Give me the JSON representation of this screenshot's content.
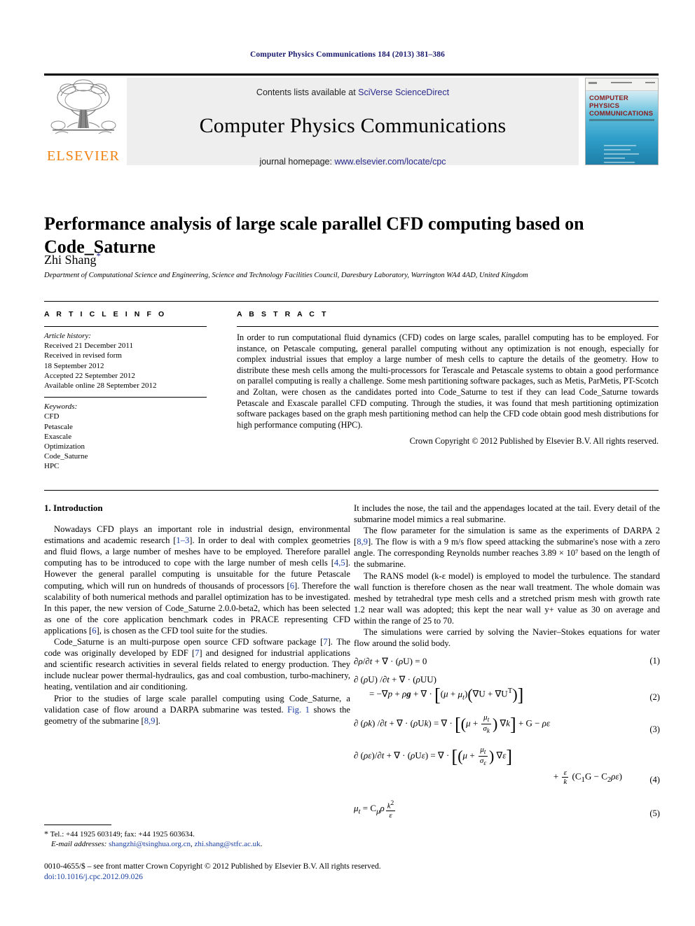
{
  "running_head": "Computer Physics Communications 184 (2013) 381–386",
  "masthead": {
    "contents_prefix": "Contents lists available at ",
    "contents_link": "SciVerse ScienceDirect",
    "journal_title": "Computer Physics Communications",
    "homepage_prefix": "journal homepage: ",
    "homepage_link": "www.elsevier.com/locate/cpc",
    "publisher_wordmark": "ELSEVIER",
    "cover_title_line1": "COMPUTER PHYSICS",
    "cover_title_line2": "COMMUNICATIONS"
  },
  "article": {
    "title": "Performance analysis of large scale parallel CFD computing based on Code_Saturne",
    "author": "Zhi Shang",
    "author_marker": "*",
    "affiliation": "Department of Computational Science and Engineering, Science and Technology Facilities Council, Daresbury Laboratory, Warrington WA4 4AD, United Kingdom"
  },
  "article_info": {
    "heading": "A R T I C L E   I N F O",
    "history_label": "Article history:",
    "history": [
      "Received 21 December 2011",
      "Received in revised form",
      "18 September 2012",
      "Accepted 22 September 2012",
      "Available online 28 September 2012"
    ],
    "keywords_label": "Keywords:",
    "keywords": [
      "CFD",
      "Petascale",
      "Exascale",
      "Optimization",
      "Code_Saturne",
      "HPC"
    ]
  },
  "abstract": {
    "heading": "A B S T R A C T",
    "text": "In order to run computational fluid dynamics (CFD) codes on large scales, parallel computing has to be employed. For instance, on Petascale computing, general parallel computing without any optimization is not enough, especially for complex industrial issues that employ a large number of mesh cells to capture the details of the geometry. How to distribute these mesh cells among the multi-processors for Terascale and Petascale systems to obtain a good performance on parallel computing is really a challenge. Some mesh partitioning software packages, such as Metis, ParMetis, PT-Scotch and Zoltan, were chosen as the candidates ported into Code_Saturne to test if they can lead Code_Saturne towards Petascale and Exascale parallel CFD computing. Through the studies, it was found that mesh partitioning optimization software packages based on the graph mesh partitioning method can help the CFD code obtain good mesh distributions for high performance computing (HPC).",
    "copyright": "Crown Copyright © 2012 Published by Elsevier B.V. All rights reserved."
  },
  "body": {
    "section1_heading": "1. Introduction",
    "left_paragraphs": [
      {
        "parts": [
          {
            "t": "Nowadays CFD plays an important role in industrial design, environmental estimations and academic research ["
          },
          {
            "t": "1–3",
            "link": true
          },
          {
            "t": "]. In order to deal with complex geometries and fluid flows, a large number of meshes have to be employed. Therefore parallel computing has to be introduced to cope with the large number of mesh cells ["
          },
          {
            "t": "4,5",
            "link": true
          },
          {
            "t": "]. However the general parallel computing is unsuitable for the future Petascale computing, which will run on hundreds of thousands of processors ["
          },
          {
            "t": "6",
            "link": true
          },
          {
            "t": "]. Therefore the scalability of both numerical methods and parallel optimization has to be investigated. In this paper, the new version of Code_Saturne 2.0.0-beta2, which has been selected as one of the core application benchmark codes in PRACE representing CFD applications ["
          },
          {
            "t": "6",
            "link": true
          },
          {
            "t": "], is chosen as the CFD tool suite for the studies."
          }
        ]
      },
      {
        "parts": [
          {
            "t": "Code_Saturne is an multi-purpose open source CFD software package ["
          },
          {
            "t": "7",
            "link": true
          },
          {
            "t": "]. The code was originally developed by EDF ["
          },
          {
            "t": "7",
            "link": true
          },
          {
            "t": "] and designed for industrial applications and scientific research activities in several fields related to energy production. They include nuclear power thermal-hydraulics, gas and coal combustion, turbo-machinery, heating, ventilation and air conditioning."
          }
        ]
      },
      {
        "parts": [
          {
            "t": "Prior to the studies of large scale parallel computing using Code_Saturne, a validation case of flow around a DARPA submarine was tested. "
          },
          {
            "t": "Fig. 1",
            "link": true
          },
          {
            "t": " shows the geometry of the submarine ["
          },
          {
            "t": "8,9",
            "link": true
          },
          {
            "t": "]."
          }
        ]
      }
    ],
    "right_paragraphs": [
      {
        "noindent": true,
        "parts": [
          {
            "t": "It includes the nose, the tail and the appendages located at the tail. Every detail of the submarine model mimics a real submarine."
          }
        ]
      },
      {
        "parts": [
          {
            "t": "The flow parameter for the simulation is same as the experiments of DARPA 2 ["
          },
          {
            "t": "8,9",
            "link": true
          },
          {
            "t": "]. The flow is with a 9 m/s flow speed attacking the submarine's nose with a zero angle. The corresponding Reynolds number reaches 3.89 × 10⁷ based on the length of the submarine."
          }
        ]
      },
      {
        "parts": [
          {
            "t": "The RANS model (k-ε model) is employed to model the turbulence. The standard wall function is therefore chosen as the near wall treatment. The whole domain was meshed by tetrahedral type mesh cells and a stretched prism mesh with growth rate 1.2 near wall was adopted; this kept the near wall y+ value as 30 on average and within the range of 25 to 70."
          }
        ]
      },
      {
        "parts": [
          {
            "t": "The simulations were carried by solving the Navier–Stokes equations for water flow around the solid body."
          }
        ]
      }
    ],
    "equation_numbers": [
      "(1)",
      "(2)",
      "(3)",
      "(4)",
      "(5)"
    ]
  },
  "footnote": {
    "marker": "*",
    "tel": "Tel.: +44 1925 603149; fax: +44 1925 603634.",
    "email_label": "E-mail addresses:",
    "email1": "shangzhi@tsinghua.org.cn",
    "email_sep": ", ",
    "email2": "zhi.shang@stfc.ac.uk",
    "email_end": "."
  },
  "footer": {
    "issn_line": "0010-4655/$ – see front matter Crown Copyright © 2012 Published by Elsevier B.V. All rights reserved.",
    "doi": "doi:10.1016/j.cpc.2012.09.026"
  },
  "colors": {
    "link": "#1a3fa0",
    "running_head": "#1a1a6e",
    "elsevier_orange": "#f08010",
    "cover_red": "#8b1a1a"
  }
}
